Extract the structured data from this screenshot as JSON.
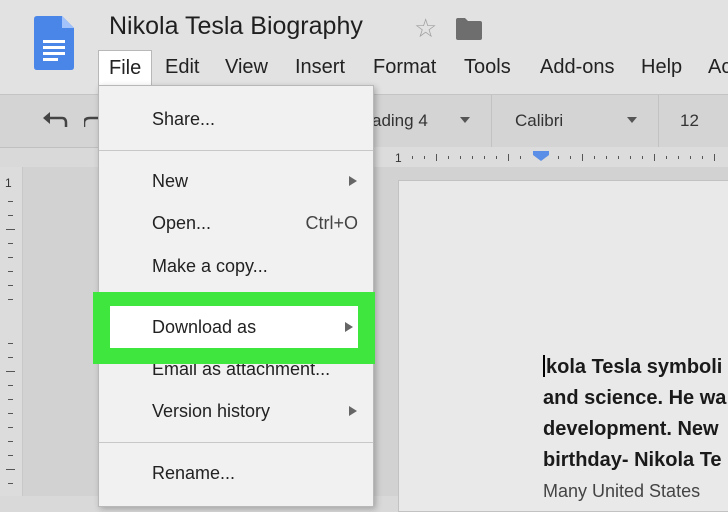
{
  "app": {
    "doc_title": "Nikola Tesla Biography",
    "icons": {
      "logo": "google-docs-icon",
      "star": "star-icon",
      "folder": "folder-icon",
      "undo": "undo-icon"
    }
  },
  "menubar": [
    "File",
    "Edit",
    "View",
    "Insert",
    "Format",
    "Tools",
    "Add-ons",
    "Help",
    "Ac"
  ],
  "toolbar": {
    "style": "ading 4",
    "font": "Calibri",
    "size": "12"
  },
  "file_menu": {
    "share": "Share...",
    "new": "New",
    "open": "Open...",
    "open_shortcut": "Ctrl+O",
    "make_copy": "Make a copy...",
    "download_as": "Download as",
    "email": "Email as attachment...",
    "version_history": "Version history",
    "rename": "Rename..."
  },
  "document": {
    "lines": [
      "kola Tesla symboli",
      "and science. He wa",
      "development. New",
      "birthday- Nikola Te"
    ],
    "partial_line": "Many United States"
  },
  "colors": {
    "highlight": "#3ee63e",
    "logo_blue": "#4a86e8"
  }
}
